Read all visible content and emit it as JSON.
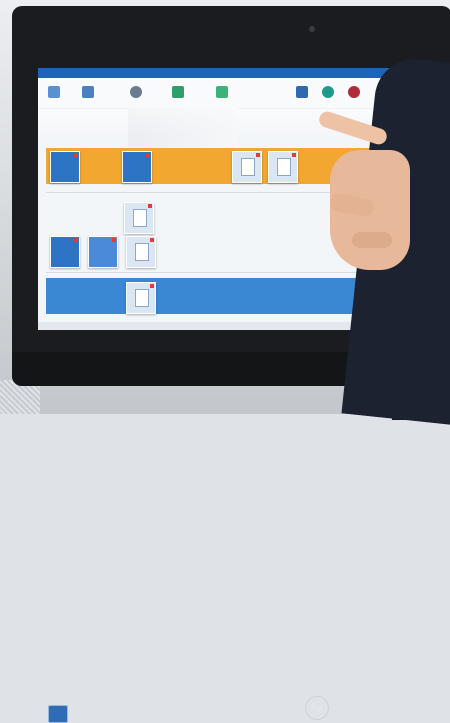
{
  "scene": {
    "description_type": "photo of touchscreen all-in-one computer",
    "brand_logo": "hp",
    "tiles": [
      {
        "id": "t1",
        "kind": "app"
      },
      {
        "id": "t2",
        "kind": "app"
      },
      {
        "id": "t3",
        "kind": "doc"
      },
      {
        "id": "t4",
        "kind": "doc"
      },
      {
        "id": "t5",
        "kind": "doc"
      },
      {
        "id": "t6",
        "kind": "app"
      },
      {
        "id": "t7",
        "kind": "app"
      },
      {
        "id": "t8",
        "kind": "doc"
      },
      {
        "id": "t9",
        "kind": "doc"
      }
    ]
  },
  "colors": {
    "accent_orange": "#f2a830",
    "accent_blue": "#3a88d4",
    "title_bar": "#1f63b8"
  }
}
